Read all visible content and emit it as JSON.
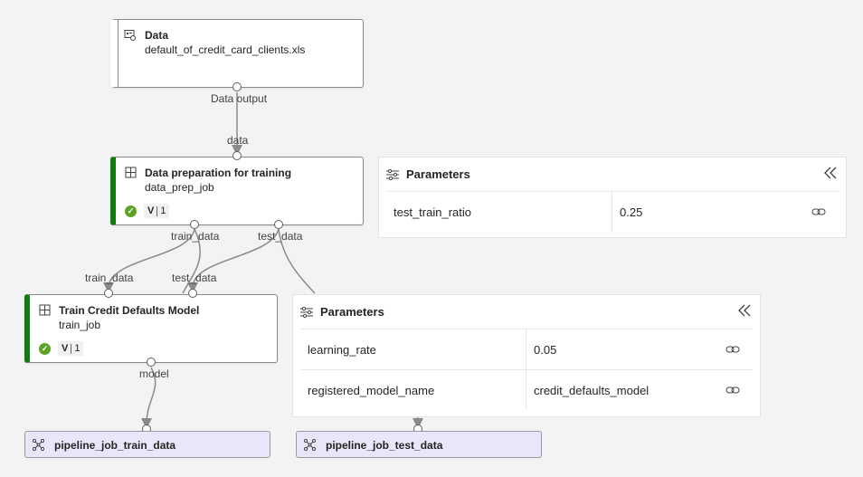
{
  "colors": {
    "canvas": "#f3f3f3",
    "success": "#107c10",
    "output_bg": "#e8e6f9",
    "edge": "#8a8a8a"
  },
  "nodes": {
    "data": {
      "title": "Data",
      "subtitle": "default_of_credit_card_clients.xls",
      "icon": "dataset-icon",
      "output_port": "Data output"
    },
    "prep": {
      "title": "Data preparation for training",
      "subtitle": "data_prep_job",
      "icon": "component-icon",
      "input_port": "data",
      "status": "success",
      "version_label": "V",
      "version_number": "1",
      "output_ports": [
        "train_data",
        "test_data"
      ]
    },
    "train": {
      "title": "Train Credit Defaults Model",
      "subtitle": "train_job",
      "icon": "component-icon",
      "input_ports": [
        "train_data",
        "test_data"
      ],
      "status": "success",
      "version_label": "V",
      "version_number": "1",
      "output_port": "model"
    }
  },
  "panels": {
    "prep_params": {
      "title": "Parameters",
      "rows": [
        {
          "name": "test_train_ratio",
          "value": "0.25"
        }
      ]
    },
    "train_params": {
      "title": "Parameters",
      "rows": [
        {
          "name": "learning_rate",
          "value": "0.05"
        },
        {
          "name": "registered_model_name",
          "value": "credit_defaults_model"
        }
      ]
    }
  },
  "outputs": {
    "train_output": {
      "name": "pipeline_job_train_data",
      "icon": "pipeline-output-icon"
    },
    "test_output": {
      "name": "pipeline_job_test_data",
      "icon": "pipeline-output-icon"
    }
  }
}
